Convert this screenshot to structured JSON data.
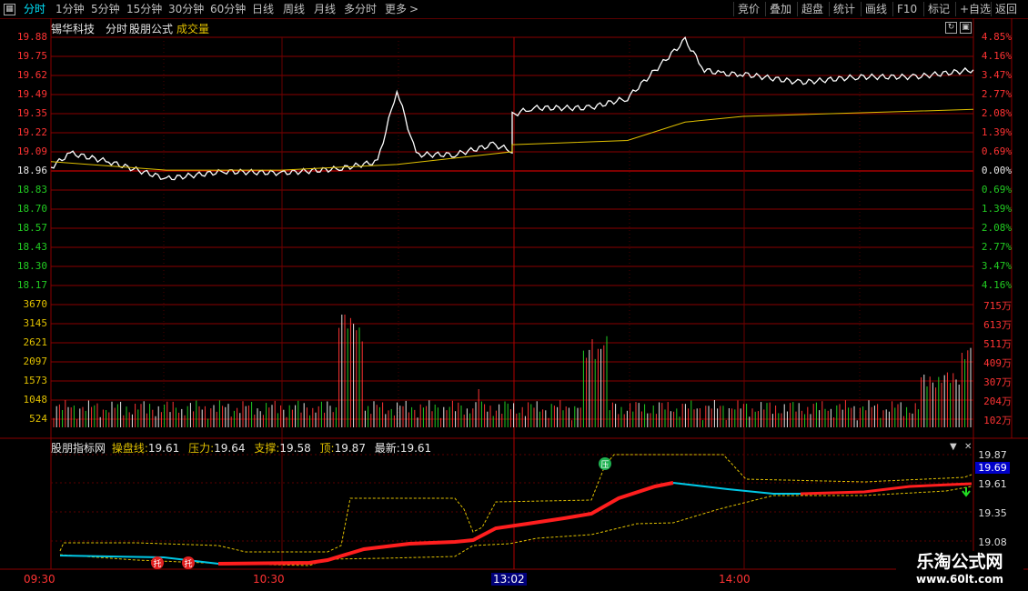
{
  "toolbar": {
    "grid_icon": "grid-icon",
    "periods": [
      "分时",
      "1分钟",
      "5分钟",
      "15分钟",
      "30分钟",
      "60分钟",
      "日线",
      "周线",
      "月线",
      "多分时",
      "更多"
    ],
    "more_arrow": ">",
    "right_buttons": [
      "竞价",
      "叠加",
      "超盘",
      "统计",
      "画线",
      "F10",
      "标记",
      "+自选",
      "返回"
    ]
  },
  "header": {
    "stock_name": "锡华科技",
    "chart_mode": "分时",
    "formula": "股朋公式",
    "volume_label": "成交量"
  },
  "price_axis_left": [
    "19.88",
    "19.75",
    "19.62",
    "19.49",
    "19.35",
    "19.22",
    "19.09",
    "18.96",
    "18.83",
    "18.70",
    "18.57",
    "18.43",
    "18.30",
    "18.17"
  ],
  "price_axis_right": [
    "4.85%",
    "4.16%",
    "3.47%",
    "2.77%",
    "2.08%",
    "1.39%",
    "0.69%",
    "0.00%",
    "0.69%",
    "1.39%",
    "2.08%",
    "2.77%",
    "3.47%",
    "4.16%"
  ],
  "volume_axis_left": [
    "3670",
    "3145",
    "2621",
    "2097",
    "1573",
    "1048",
    "524"
  ],
  "volume_axis_right": [
    "715万",
    "613万",
    "511万",
    "409万",
    "307万",
    "204万",
    "102万"
  ],
  "indicator": {
    "name": "股朋指标网",
    "line_label": "操盘线:",
    "line_value": "19.61",
    "pressure_label": "压力:",
    "pressure_value": "19.64",
    "support_label": "支撑:",
    "support_value": "19.58",
    "top_label": "顶:",
    "top_value": "19.87",
    "latest_label": "最新:",
    "latest_value": "19.61",
    "axis": [
      "19.87",
      "19.61",
      "19.35",
      "19.08"
    ],
    "current_tag": "19.69",
    "marker_support": "托",
    "marker_pressure": "压"
  },
  "time_axis": [
    "09:30",
    "10:30",
    "13:02",
    "14:00"
  ],
  "watermark": {
    "title": "乐淘公式网",
    "url": "www.60lt.com"
  },
  "colors": {
    "grid": "#8a0000",
    "price_line": "#ffffff",
    "avg_line": "#e0c000",
    "up": "#ff3333",
    "down": "#22cc22"
  },
  "chart_data": {
    "type": "line",
    "title": "",
    "prev_close": 18.96,
    "ylim": [
      18.04,
      19.88
    ],
    "series": [
      {
        "name": "",
        "x": [
          "09:30",
          "09:35",
          "09:45",
          "10:00",
          "10:15",
          "10:30",
          "10:45",
          "10:55",
          "11:00",
          "11:05",
          "11:15",
          "11:25",
          "11:30",
          "13:00",
          "13:05",
          "13:20",
          "13:30",
          "13:45",
          "13:50",
          "13:55",
          "14:00",
          "14:15",
          "14:30",
          "14:45",
          "15:00"
        ],
        "values": [
          18.96,
          19.06,
          19.0,
          18.88,
          18.93,
          18.92,
          18.95,
          19.0,
          19.51,
          19.05,
          19.05,
          19.12,
          19.08,
          19.33,
          19.38,
          19.38,
          19.45,
          19.86,
          19.65,
          19.62,
          19.62,
          19.56,
          19.6,
          19.6,
          19.65
        ]
      },
      {
        "name": "",
        "x": [
          "09:30",
          "10:00",
          "10:30",
          "11:00",
          "11:30",
          "13:00",
          "13:30",
          "13:45",
          "14:00",
          "15:00"
        ],
        "values": [
          19.0,
          18.94,
          18.94,
          18.98,
          19.07,
          19.12,
          19.15,
          19.28,
          19.32,
          19.37
        ]
      }
    ]
  }
}
